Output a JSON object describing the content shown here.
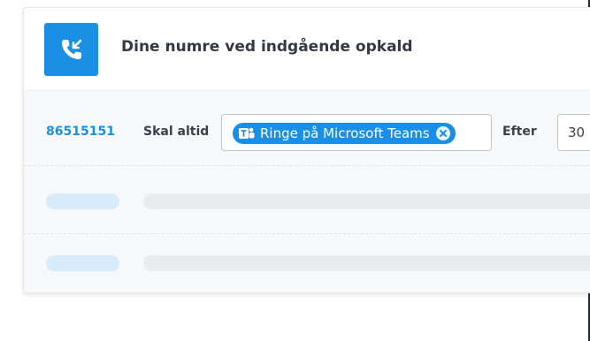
{
  "header": {
    "title": "Dine numre ved indgående opkald",
    "icon": "incoming-call-icon"
  },
  "row": {
    "number": "86515151",
    "always_label": "Skal altid",
    "chip": {
      "label": "Ringe på Microsoft Teams",
      "icon": "microsoft-teams-icon",
      "remove_icon": "remove-chip-icon"
    },
    "after_label": "Efter",
    "delay_value": "30"
  },
  "colors": {
    "accent": "#1a8fe3",
    "skeleton_short": "#d8ebfb",
    "skeleton_long": "#e9ebee",
    "body_background": "#f7f8fa"
  }
}
